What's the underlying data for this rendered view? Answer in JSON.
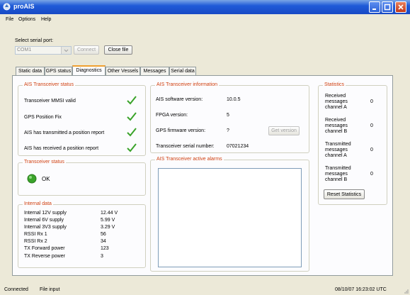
{
  "window": {
    "title": "proAIS"
  },
  "menu": [
    "File",
    "Options",
    "Help"
  ],
  "serial": {
    "label": "Select serial port:",
    "port": "COM1",
    "connect_label": "Connect",
    "close_label": "Close file"
  },
  "tabs": [
    "Static data",
    "GPS status",
    "Diagnostics",
    "Other Vessels",
    "Messages",
    "Serial data"
  ],
  "active_tab": "Diagnostics",
  "ais_status": {
    "title": "AIS Transceiver status",
    "items": [
      "Transceiver MMSI valid",
      "GPS Position Fix",
      "AIS has transmitted a position report",
      "AIS has received a position report"
    ]
  },
  "transceiver_status": {
    "title": "Transceiver status",
    "value": "OK",
    "led_color": "#3aa32a"
  },
  "internal_data": {
    "title": "Internal data",
    "rows": [
      {
        "label": "Internal 12V supply",
        "value": "12.44 V"
      },
      {
        "label": "Internal 6V supply",
        "value": "5.99 V"
      },
      {
        "label": "Internal 3V3 supply",
        "value": "3.29 V"
      },
      {
        "label": "RSSI Rx 1",
        "value": "56"
      },
      {
        "label": "RSSI Rx 2",
        "value": "34"
      },
      {
        "label": "TX Forward power",
        "value": "123"
      },
      {
        "label": "TX Reverse power",
        "value": "3"
      }
    ]
  },
  "ais_info": {
    "title": "AIS Transceiver information",
    "rows": [
      {
        "label": "AIS software version:",
        "value": "10.0.5"
      },
      {
        "label": "FPGA version:",
        "value": "5"
      },
      {
        "label": "GPS firmware version:",
        "value": "?"
      },
      {
        "label": "Transceiver serial number:",
        "value": "07021234"
      }
    ],
    "get_version_label": "Get version"
  },
  "alarms": {
    "title": "AIS Transceiver active alarms"
  },
  "statistics": {
    "title": "Statistics",
    "rows": [
      {
        "line1": "Received",
        "line2": "messages",
        "line3": "channel A",
        "value": "0"
      },
      {
        "line1": "Received",
        "line2": "messages",
        "line3": "channel B",
        "value": "0"
      },
      {
        "line1": "Transmitted",
        "line2": "messages",
        "line3": "channel A",
        "value": "0"
      },
      {
        "line1": "Transmitted",
        "line2": "messages",
        "line3": "channel B",
        "value": "0"
      }
    ],
    "reset_label": "Reset Statistics"
  },
  "statusbar": {
    "connection": "Connected",
    "mode": "File input",
    "datetime": "08/10/07 16:23:02 UTC"
  },
  "colors": {
    "accent_title": "#d04010",
    "check": "#3aa32a",
    "titlebar": "#1f5bd8"
  }
}
